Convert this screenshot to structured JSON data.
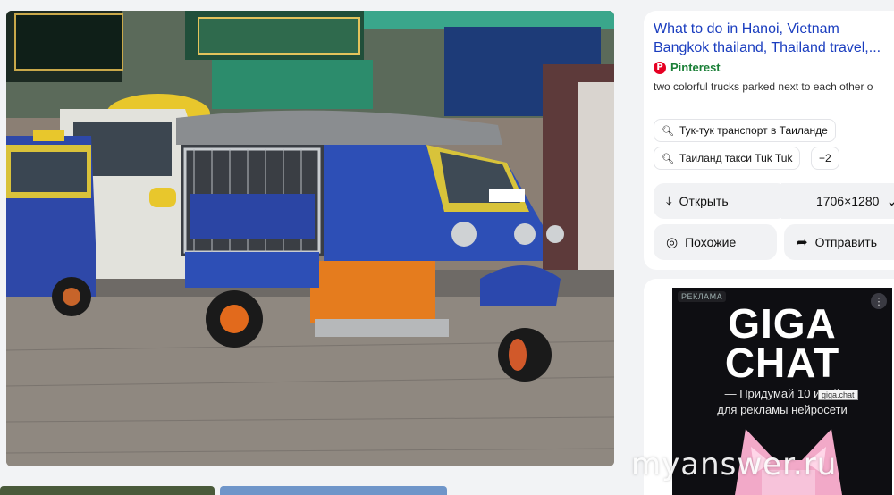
{
  "result": {
    "title_line1": "What to do in Hanoi, Vietnam",
    "title_line2": "Bangkok thailand, Thailand travel,...",
    "source_name": "Pinterest",
    "source_icon": "pinterest-icon",
    "description": "two colorful trucks parked next to each other o",
    "link_color": "#1a3dbf"
  },
  "tags": [
    {
      "label": "Тук-тук транспорт в Таиланде",
      "icon": "search-icon"
    },
    {
      "label": "Таиланд такси Tuk Tuk",
      "icon": "search-icon"
    },
    {
      "label": "+2"
    }
  ],
  "actions": {
    "open_label": "Открыть",
    "open_icon": "download-icon",
    "size_label": "1706×1280",
    "similar_label": "Похожие",
    "similar_icon": "lens-icon",
    "share_label": "Отправить",
    "share_icon": "share-icon"
  },
  "ad": {
    "badge": "РЕКЛАМА",
    "headline_1": "GIGA",
    "headline_2": "CHAT",
    "text_line1": "— Придумай 10 идей",
    "text_line2": "для рекламы нейросети",
    "tooltip": "giga.chat"
  },
  "watermark": "myanswer.ru"
}
